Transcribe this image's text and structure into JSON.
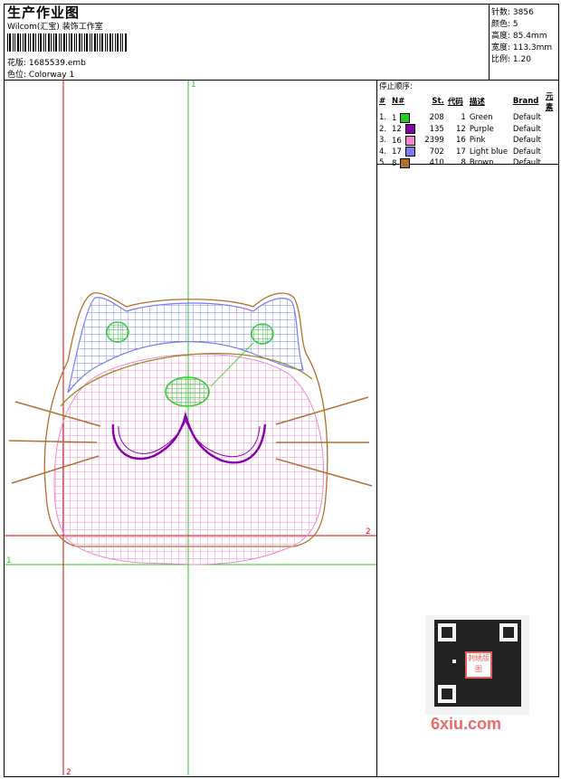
{
  "header": {
    "title": "生产作业图",
    "company": "Wilcom(汇宝) 装饰工作室",
    "design_label": "花版: 1685539.emb",
    "colorway_label": "色位: Colorway 1"
  },
  "stats": {
    "stitches": "针数: 3856",
    "colors": "颜色: 5",
    "height": "高度: 85.4mm",
    "width": "宽度: 113.3mm",
    "scale": "比例: 1.20"
  },
  "stop_sequence": {
    "title": "停止顺序:",
    "columns": [
      "#",
      "N#",
      "St.",
      "代码",
      "描述",
      "Brand",
      "元素"
    ],
    "rows": [
      {
        "idx": "1.",
        "n": "1",
        "st": "208",
        "code": "1",
        "desc": "Green",
        "brand": "Default",
        "color": "#22cc22"
      },
      {
        "idx": "2.",
        "n": "12",
        "st": "135",
        "code": "12",
        "desc": "Purple",
        "brand": "Default",
        "color": "#8800aa"
      },
      {
        "idx": "3.",
        "n": "16",
        "st": "2399",
        "code": "16",
        "desc": "Pink",
        "brand": "Default",
        "color": "#ee88cc"
      },
      {
        "idx": "4.",
        "n": "17",
        "st": "702",
        "code": "17",
        "desc": "Light blue",
        "brand": "Default",
        "color": "#7c7cf0"
      },
      {
        "idx": "5.",
        "n": "8",
        "st": "410",
        "code": "8",
        "desc": "Brown",
        "brand": "Default",
        "color": "#b07030"
      }
    ]
  },
  "guides": {
    "green_top": "1",
    "green_left": "1",
    "red_right": "2",
    "red_bottom": "2"
  },
  "watermark": {
    "site": "6xiu.com",
    "stamp": "刺绣版图"
  },
  "colors": {
    "green": "#22cc22",
    "red": "#e00000",
    "pink": "#ee88cc",
    "blue": "#7c7cf0",
    "purple": "#8800aa",
    "brown": "#b07030"
  }
}
